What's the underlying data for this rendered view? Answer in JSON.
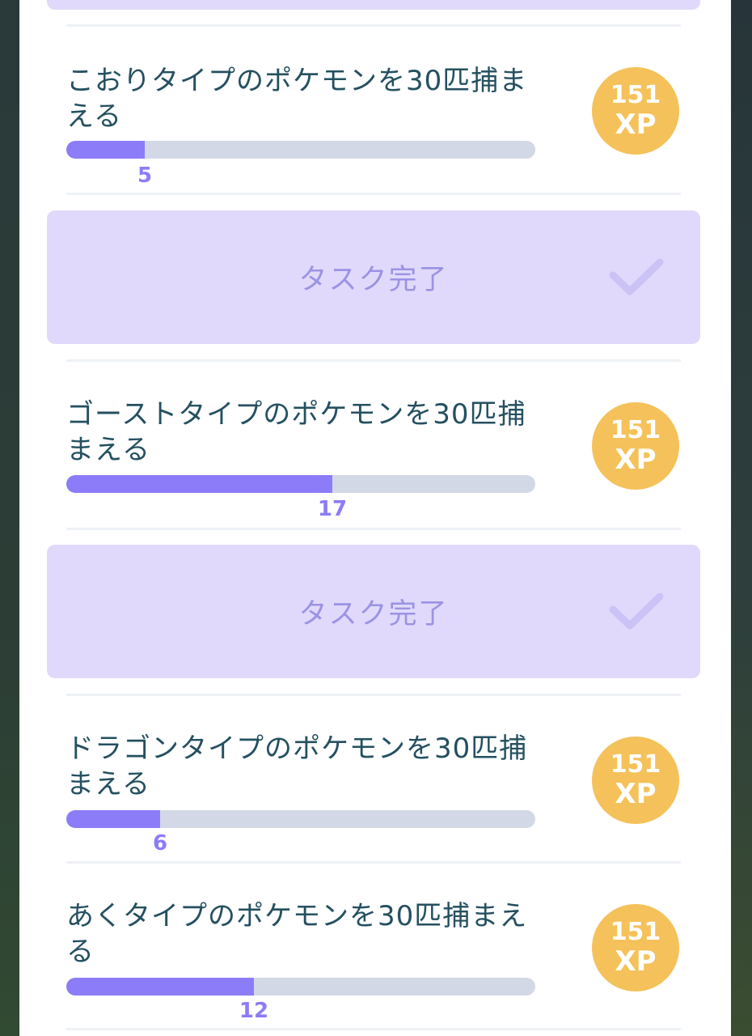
{
  "colors": {
    "accent": "#8c7cf7",
    "completed_bg": "#e1d9fb",
    "xp_badge": "#f5c15a",
    "text": "#245060",
    "bar_track": "#d3d8e6"
  },
  "tasks": [
    {
      "title": "こおりタイプのポケモンを30匹捕まえる",
      "progress": 5,
      "goal": 30,
      "count_label": "5",
      "reward_value": "151",
      "reward_unit": "XP"
    },
    {
      "completed_label": "タスク完了",
      "icon": "checkmark-icon"
    },
    {
      "title": "ゴーストタイプのポケモンを30匹捕まえる",
      "progress": 17,
      "goal": 30,
      "count_label": "17",
      "reward_value": "151",
      "reward_unit": "XP"
    },
    {
      "completed_label": "タスク完了",
      "icon": "checkmark-icon"
    },
    {
      "title": "ドラゴンタイプのポケモンを30匹捕まえる",
      "progress": 6,
      "goal": 30,
      "count_label": "6",
      "reward_value": "151",
      "reward_unit": "XP"
    },
    {
      "title": "あくタイプのポケモンを30匹捕まえる",
      "progress": 12,
      "goal": 30,
      "count_label": "12",
      "reward_value": "151",
      "reward_unit": "XP"
    }
  ]
}
